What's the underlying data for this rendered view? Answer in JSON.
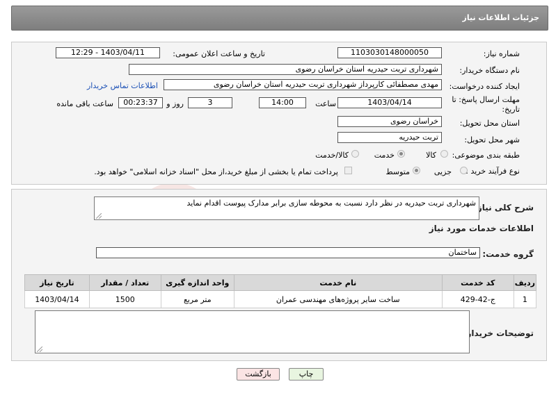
{
  "header": {
    "title": "جزئیات اطلاعات نیاز"
  },
  "form": {
    "need_number_label": "شماره نیاز:",
    "need_number": "1103030148000050",
    "announce_label": "تاریخ و ساعت اعلان عمومی:",
    "announce_value": "1403/04/11 - 12:29",
    "buyer_org_label": "نام دستگاه خریدار:",
    "buyer_org": "شهرداری تربت حیدریه استان خراسان رضوی",
    "creator_label": "ایجاد کننده درخواست:",
    "creator": "مهدی مصطفائی کارپرداز شهرداری تربت حیدریه استان خراسان رضوی",
    "contact_link": "اطلاعات تماس خریدار",
    "deadline_label_1": "مهلت ارسال پاسخ: تا",
    "deadline_label_2": "تاریخ:",
    "deadline_date": "1403/04/14",
    "time_label": "ساعت",
    "deadline_time": "14:00",
    "days": "3",
    "days_label": "روز و",
    "remaining": "00:23:37",
    "remaining_label": "ساعت باقی مانده",
    "province_label": "استان محل تحویل:",
    "province": "خراسان رضوی",
    "city_label": "شهر محل تحویل:",
    "city": "تربت حیدریه",
    "category_label": "طبقه بندی موضوعی:",
    "category_options": [
      "کالا",
      "خدمت",
      "کالا/خدمت"
    ],
    "process_label": "نوع فرآیند خرید :",
    "process_options": [
      "جزیی",
      "متوسط"
    ],
    "payment_note": "پرداخت تمام یا بخشی از مبلغ خرید،از محل \"اسناد خزانه اسلامی\" خواهد بود."
  },
  "summary": {
    "label": "شرح کلی نیاز:",
    "text": "شهرداری تربت حیدریه در نظر دارد نسبت به محوطه سازی برابر مدارک پیوست اقدام نماید"
  },
  "services": {
    "title": "اطلاعات خدمات مورد نیاز",
    "group_label": "گروه خدمت:",
    "group_value": "ساختمان",
    "columns": [
      "ردیف",
      "کد خدمت",
      "نام خدمت",
      "واحد اندازه گیری",
      "تعداد / مقدار",
      "تاریخ نیاز"
    ],
    "rows": [
      [
        "1",
        "ج-42-429",
        "ساخت سایر پروژه‌های مهندسی عمران",
        "متر مربع",
        "1500",
        "1403/04/14"
      ]
    ]
  },
  "buyer_notes": {
    "label": "توضیحات خریدار:",
    "text": ""
  },
  "buttons": {
    "print": "چاپ",
    "back": "بازگشت"
  },
  "watermark": {
    "text": "AriaTender.neT",
    "color": "#c0392b"
  }
}
